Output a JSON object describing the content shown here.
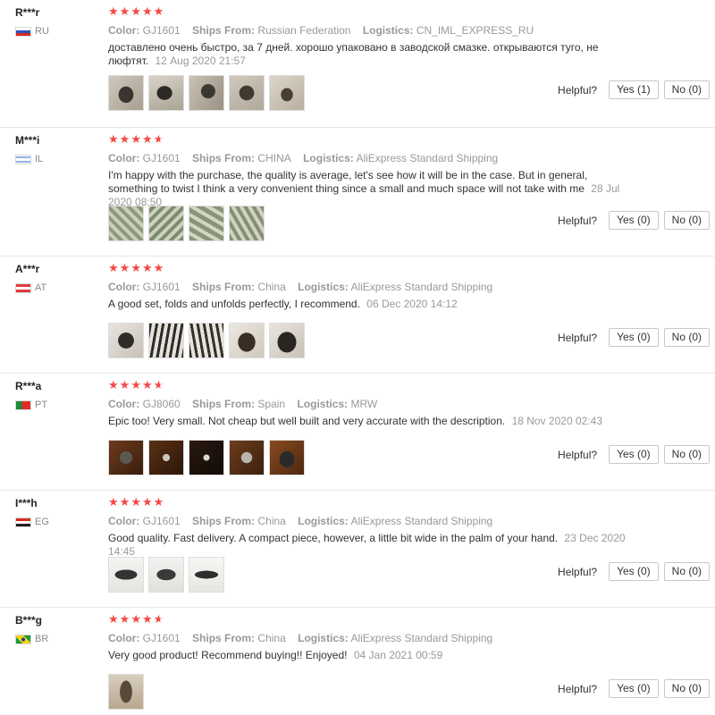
{
  "labels": {
    "color": "Color:",
    "ships_from": "Ships From:",
    "logistics": "Logistics:",
    "helpful": "Helpful?"
  },
  "reviews": [
    {
      "user": "R***r",
      "country": "RU",
      "stars": 5,
      "color": "GJ1601",
      "ships_from": "Russian Federation",
      "logistics": "CN_IML_EXPRESS_RU",
      "text": "доставлено очень быстро, за 7 дней. хорошо упаковано в заводской смазке. открываются туго, не люфтят.",
      "date": "12 Aug 2020 21:57",
      "yes": "Yes (1)",
      "no": "No (0)"
    },
    {
      "user": "M***i",
      "country": "IL",
      "stars": 4.5,
      "color": "GJ1601",
      "ships_from": "CHINA",
      "logistics": "AliExpress Standard Shipping",
      "text": "I'm happy with the purchase, the quality is average, let's see how it will be in the case. But in general, something to twist I think a very convenient thing since a small and much space will not take with me",
      "date": "28 Jul 2020 08:50",
      "yes": "Yes (0)",
      "no": "No (0)"
    },
    {
      "user": "A***r",
      "country": "AT",
      "stars": 5,
      "color": "GJ1601",
      "ships_from": "China",
      "logistics": "AliExpress Standard Shipping",
      "text": "A good set, folds and unfolds perfectly, I recommend.",
      "date": "06 Dec 2020 14:12",
      "yes": "Yes (0)",
      "no": "No (0)"
    },
    {
      "user": "R***a",
      "country": "PT",
      "stars": 4.5,
      "color": "GJ8060",
      "ships_from": "Spain",
      "logistics": "MRW",
      "text": "Epic too! Very small. Not cheap but well built and very accurate with the description.",
      "date": "18 Nov 2020 02:43",
      "yes": "Yes (0)",
      "no": "No (0)"
    },
    {
      "user": "I***h",
      "country": "EG",
      "stars": 5,
      "color": "GJ1601",
      "ships_from": "China",
      "logistics": "AliExpress Standard Shipping",
      "text": "Good quality. Fast delivery. A compact piece, however, a little bit wide in the palm of your hand.",
      "date": "23 Dec 2020 14:45",
      "yes": "Yes (0)",
      "no": "No (0)"
    },
    {
      "user": "B***g",
      "country": "BR",
      "stars": 4.5,
      "color": "GJ1601",
      "ships_from": "China",
      "logistics": "AliExpress Standard Shipping",
      "text": "Very good product! Recommend buying!! Enjoyed!",
      "date": "04 Jan 2021 00:59",
      "yes": "Yes (0)",
      "no": "No (0)"
    }
  ]
}
